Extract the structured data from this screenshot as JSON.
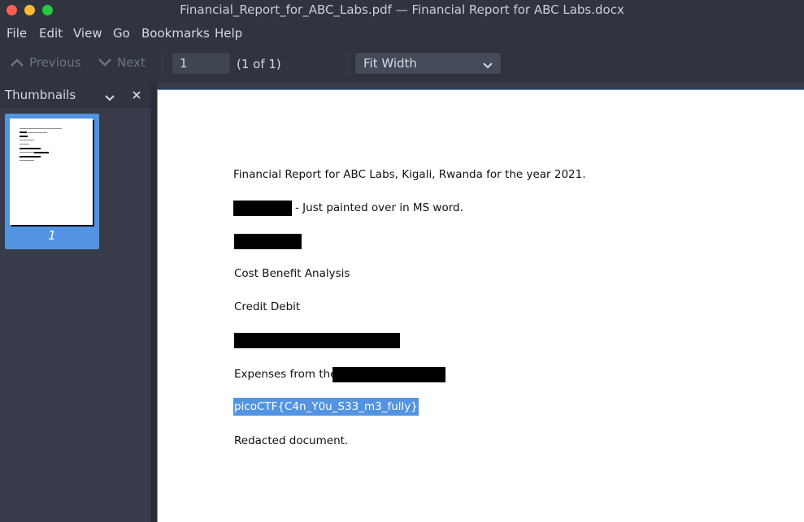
{
  "window": {
    "title": "Financial_Report_for_ABC_Labs.pdf — Financial Report for ABC Labs.docx"
  },
  "menu": {
    "items": [
      "File",
      "Edit",
      "View",
      "Go",
      "Bookmarks",
      "Help"
    ]
  },
  "toolbar": {
    "previous_label": "Previous",
    "next_label": "Next",
    "page_value": "1",
    "page_count": "(1 of 1)",
    "zoom_value": "Fit Width"
  },
  "sidebar": {
    "title": "Thumbnails",
    "thumbnails": [
      {
        "page_label": "1"
      }
    ]
  },
  "document": {
    "lines": [
      "Financial Report for ABC Labs, Kigali, Rwanda for the year 2021.",
      "- Just painted over in MS word.",
      "Cost Benefit Analysis",
      "Credit Debit",
      "Expenses from the",
      "picoCTF{C4n_Y0u_S33_m3_fully}",
      "Redacted document."
    ]
  },
  "colors": {
    "accent": "#5294e2",
    "window_bg": "#2f343f",
    "sidebar_bg": "#383c4a",
    "redaction": "#000000"
  }
}
